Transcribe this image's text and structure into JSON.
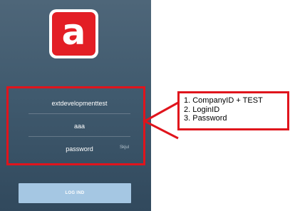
{
  "login": {
    "logo_letter": "a",
    "fields": {
      "company": "extdevelopmenttest",
      "login_id": "aaa",
      "password": "password"
    },
    "show_password_label": "Skjul",
    "login_button": "LOG IND"
  },
  "annotation": {
    "lines": [
      "1. CompanyID + TEST",
      "2. LoginID",
      "3. Password"
    ]
  },
  "colors": {
    "brand_red": "#e31e25",
    "highlight_red": "#e0141c",
    "button_blue": "#a5c7e3",
    "background_top": "#4e6679",
    "background_bottom": "#31495d"
  }
}
